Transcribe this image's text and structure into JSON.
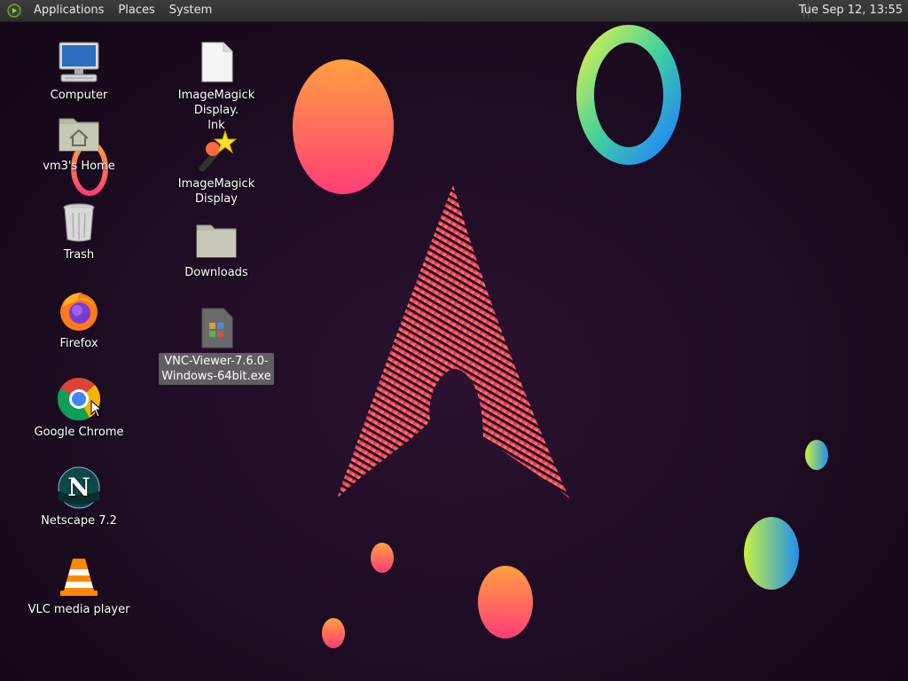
{
  "panel": {
    "menus": [
      "Applications",
      "Places",
      "System"
    ],
    "clock": "Tue Sep 12, 13:55"
  },
  "desktop": {
    "icons_col1": [
      {
        "label": "Computer",
        "icon": "computer-icon"
      },
      {
        "label": "vm3's Home",
        "icon": "home-folder-icon"
      },
      {
        "label": "Trash",
        "icon": "trash-icon"
      },
      {
        "label": "Firefox",
        "icon": "firefox-icon"
      },
      {
        "label": "Google Chrome",
        "icon": "chrome-icon"
      },
      {
        "label": "Netscape 7.2",
        "icon": "netscape-icon"
      },
      {
        "label": "VLC media player",
        "icon": "vlc-icon"
      }
    ],
    "icons_col2": [
      {
        "label": "ImageMagick Display.\nlnk",
        "icon": "file-icon"
      },
      {
        "label": "ImageMagick Display",
        "icon": "imagemagick-icon"
      },
      {
        "label": "Downloads",
        "icon": "folder-icon"
      },
      {
        "label": "VNC-Viewer-7.6.0-\nWindows-64bit.exe",
        "icon": "exe-file-icon",
        "selected": true
      }
    ]
  },
  "colors": {
    "panel": "#333333",
    "background": "#1d0c22",
    "accent_pink": "#e8336e",
    "accent_orange": "#ff8a3d"
  }
}
